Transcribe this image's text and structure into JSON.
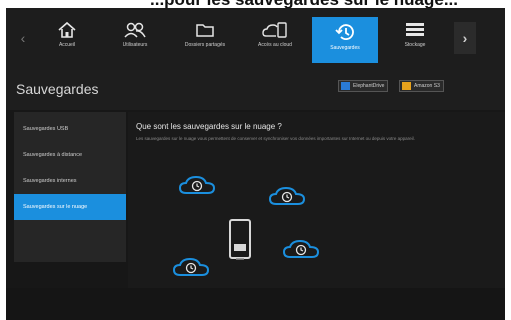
{
  "top_text": "...pour les sauvegardes sur le nuage...",
  "nav": {
    "items": [
      {
        "label": "Accueil",
        "icon": "home-icon"
      },
      {
        "label": "Utilisateurs",
        "icon": "users-icon"
      },
      {
        "label": "Dossiers partagés",
        "icon": "folder-icon"
      },
      {
        "label": "Accès au cloud",
        "icon": "cloud-access-icon"
      },
      {
        "label": "Sauvegardes",
        "icon": "backup-icon"
      },
      {
        "label": "Stockage",
        "icon": "storage-icon"
      }
    ],
    "active_index": 4
  },
  "page": {
    "title": "Sauvegardes",
    "providers": [
      {
        "label": "ElephantDrive",
        "icon": "elephantdrive-icon"
      },
      {
        "label": "Amazon S3",
        "icon": "amazon-s3-icon"
      }
    ]
  },
  "sidebar": {
    "items": [
      {
        "label": "Sauvegardes USB"
      },
      {
        "label": "Sauvegardes à distance"
      },
      {
        "label": "Sauvegardes internes"
      },
      {
        "label": "Sauvegardes sur le nuage"
      }
    ],
    "active_index": 3
  },
  "content": {
    "title": "Que sont les sauvegardes sur le nuage ?",
    "description": "Les sauvegardes sur le nuage vous permettent de conserver et synchroniser vos données importantes sur Internet ou depuis votre appareil."
  },
  "colors": {
    "accent": "#1b8fde",
    "background": "#171717",
    "panel": "#262626"
  }
}
